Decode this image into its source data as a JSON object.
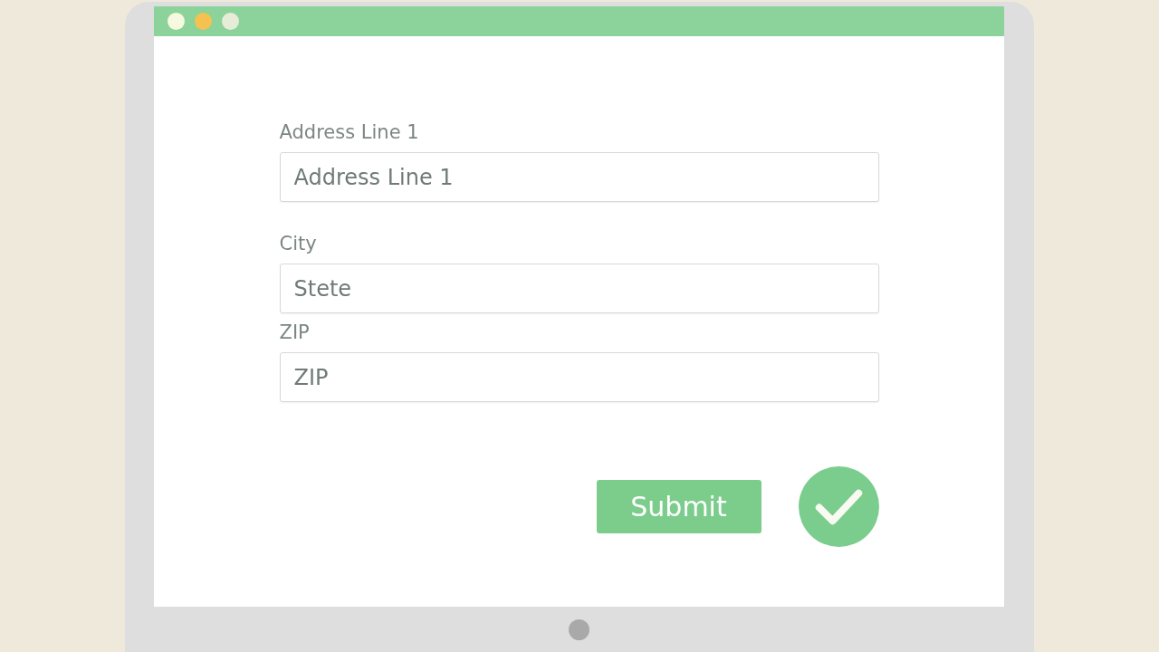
{
  "window": {
    "controls": [
      {
        "color": "#f6f8e0"
      },
      {
        "color": "#f5c150"
      },
      {
        "color": "#e6ecd8"
      }
    ]
  },
  "form": {
    "fields": [
      {
        "label": "Address Line 1",
        "placeholder": "Address Line 1"
      },
      {
        "label": "City",
        "placeholder": "Stete"
      },
      {
        "label": "ZIP",
        "placeholder": "ZIP"
      }
    ],
    "submit_button": "Submit"
  }
}
